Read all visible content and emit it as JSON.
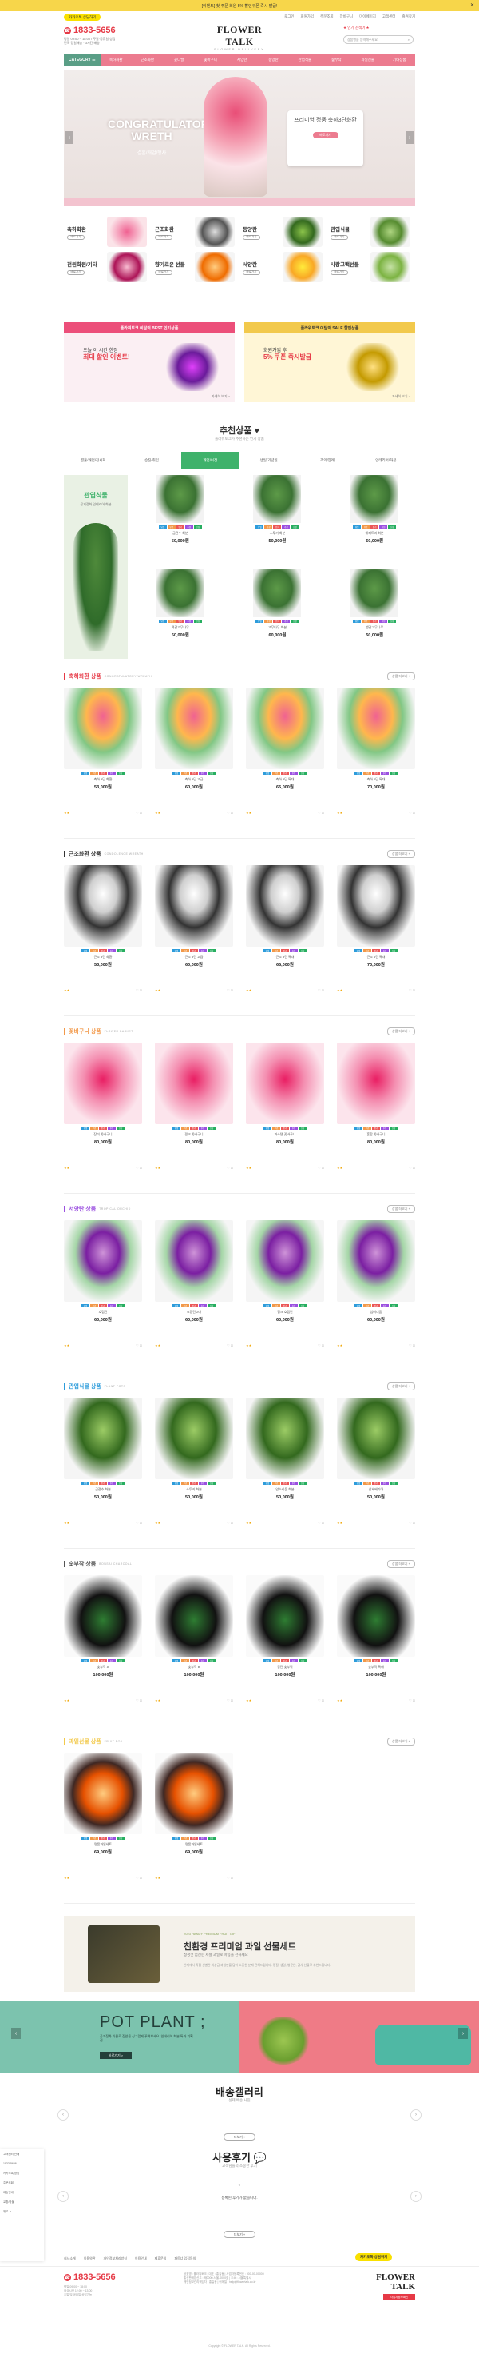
{
  "topbar": {
    "text": "[이벤트] 첫 주문 회원 5% 할인쿠폰 즉시 발급!",
    "close": "✕"
  },
  "header": {
    "kakao_label": "카카오톡 상담하기",
    "links": [
      "로그인",
      "회원가입",
      "주문조회",
      "장바구니",
      "마이페이지",
      "고객센터",
      "즐겨찾기"
    ],
    "phone": "1833-5656",
    "phone_hours": "평일 09:00 ~ 18:00 / 주말·공휴일 상담",
    "phone_hours2": "전국 당일배송 · 3시간 배송",
    "logo_main": "FLOWER TALK",
    "logo_sub": "FLOWER DELIVERY",
    "search_label": "★ 인기 검색어 ★",
    "search_placeholder": "상품명을 입력해주세요"
  },
  "nav": {
    "category": "CATEGORY ☰",
    "items": [
      "축하화환",
      "근조화환",
      "꽃다발",
      "꽃바구니",
      "서양란",
      "동양란",
      "관엽식물",
      "숲부작",
      "과일선물",
      "기타상품"
    ]
  },
  "hero": {
    "title": "CONGRATULATORY WRETH",
    "subtitle": "결혼/개업/행사",
    "card_text": "프리미엄 정품 축하3단화환",
    "card_button": "바로가기",
    "prev": "‹",
    "next": "›"
  },
  "categories": [
    {
      "name": "축하화환",
      "btn": "바로가기"
    },
    {
      "name": "근조화환",
      "btn": "바로가기"
    },
    {
      "name": "동양란",
      "btn": "바로가기"
    },
    {
      "name": "관엽식물",
      "btn": "바로가기"
    },
    {
      "name": "전원화원/기타",
      "btn": "바로가기"
    },
    {
      "name": "향기로운 선물",
      "btn": "바로가기"
    },
    {
      "name": "서양란",
      "btn": "바로가기"
    },
    {
      "name": "사랑고백선물",
      "btn": "바로가기"
    }
  ],
  "promo_banners": [
    {
      "header": "플라워토크 이달의 BEST 인기상품",
      "line1": "오늘 이 시간 한정",
      "line2": "최대 할인 이벤트!",
      "more": "자세히 보기 >"
    },
    {
      "header": "플라워토크 이달의 SALE 할인상품",
      "line1": "회원가입 후",
      "line2": "5% 쿠폰 즉시발급",
      "more": "자세히 보기 >"
    }
  ],
  "recommend": {
    "title": "추천상품 ♥",
    "subtitle": "플라워토크가 추천하는 인기 상품",
    "tabs": [
      "결혼/개업/전시회",
      "승진/취임",
      "개업/이전",
      "생일/기념일",
      "조의/장례",
      "인테리어/화분"
    ],
    "active_tab": 2,
    "featured_title": "관엽식물",
    "featured_sub": "공기정화 인테리어 화분",
    "items": [
      {
        "name": "금전수 화분",
        "price": "50,000원"
      },
      {
        "name": "스투키 화분",
        "price": "50,000원"
      },
      {
        "name": "해피트리 화분",
        "price": "50,000원"
      },
      {
        "name": "떡갈고무나무",
        "price": "60,000원"
      },
      {
        "name": "고무나무 화분",
        "price": "60,000원"
      },
      {
        "name": "뱅갈고무나무",
        "price": "50,000원"
      }
    ]
  },
  "badge_colors": [
    "#2d9cdb",
    "#f2994a",
    "#eb5757",
    "#9b51e0",
    "#27ae60"
  ],
  "badge_labels": [
    "당일",
    "무료",
    "인기",
    "추천",
    "신상"
  ],
  "sections": [
    {
      "title": "축하화환 상품",
      "en": "CONGRATULATORY WREATH",
      "color": "#e63946",
      "more": "상품 더보기 +",
      "items": [
        {
          "name": "축하 3단 화환",
          "price": "53,000원"
        },
        {
          "name": "축하 3단 고급",
          "price": "60,000원"
        },
        {
          "name": "축하 3단 특대",
          "price": "65,000원"
        },
        {
          "name": "축하 4단 특대",
          "price": "70,000원"
        }
      ]
    },
    {
      "title": "근조화환 상품",
      "en": "CONDOLENCE WREATH",
      "color": "#333333",
      "more": "상품 더보기 +",
      "items": [
        {
          "name": "근조 3단 화환",
          "price": "53,000원"
        },
        {
          "name": "근조 3단 고급",
          "price": "60,000원"
        },
        {
          "name": "근조 3단 특대",
          "price": "65,000원"
        },
        {
          "name": "근조 4단 특대",
          "price": "70,000원"
        }
      ]
    },
    {
      "title": "꽃바구니 상품",
      "en": "FLOWER BASKET",
      "color": "#f2994a",
      "more": "상품 더보기 +",
      "items": [
        {
          "name": "장미 꽃바구니",
          "price": "80,000원"
        },
        {
          "name": "핑크 꽃바구니",
          "price": "80,000원"
        },
        {
          "name": "파스텔 꽃바구니",
          "price": "80,000원"
        },
        {
          "name": "혼합 꽃바구니",
          "price": "80,000원"
        }
      ]
    },
    {
      "title": "서양란 상품",
      "en": "TROPICAL ORCHID",
      "color": "#9b51e0",
      "more": "상품 더보기 +",
      "items": [
        {
          "name": "호접란",
          "price": "60,000원"
        },
        {
          "name": "호접란 2대",
          "price": "60,000원"
        },
        {
          "name": "핑크 호접란",
          "price": "60,000원"
        },
        {
          "name": "심비디움",
          "price": "60,000원"
        }
      ]
    },
    {
      "title": "관엽식물 상품",
      "en": "PLANT POTS",
      "color": "#2d9cdb",
      "more": "상품 더보기 +",
      "items": [
        {
          "name": "금전수 화분",
          "price": "50,000원"
        },
        {
          "name": "스투키 화분",
          "price": "50,000원"
        },
        {
          "name": "안스리움 화분",
          "price": "50,000원"
        },
        {
          "name": "산세베리아",
          "price": "50,000원"
        }
      ]
    },
    {
      "title": "숯부작 상품",
      "en": "BONSAI CHARCOAL",
      "color": "#555555",
      "more": "상품 더보기 +",
      "items": [
        {
          "name": "숯부작 A",
          "price": "100,000원"
        },
        {
          "name": "숯부작 B",
          "price": "100,000원"
        },
        {
          "name": "풍란 숯부작",
          "price": "100,000원"
        },
        {
          "name": "숯부작 특대",
          "price": "100,000원"
        }
      ]
    },
    {
      "title": "과일선물 상품",
      "en": "FRUIT BOX",
      "color": "#f2c94c",
      "more": "상품 더보기 +",
      "items": [
        {
          "name": "명품과일세트",
          "price": "69,000원"
        },
        {
          "name": "명품과일세트",
          "price": "69,000원"
        }
      ]
    }
  ],
  "fruit_banner": {
    "tag": "2023 HANDY PREMIUM FRUIT GIFT",
    "title": "친환경 프리미엄 과일 선물세트",
    "sub": "정성껏 엄선한 제철 과일로 마음을 전하세요",
    "desc": "산지에서 직접 선별한 최상급 과일만을 담아 소중한 분께 전해드립니다. 명절, 생일, 병문안, 감사 선물로 추천드립니다."
  },
  "pot_banner": {
    "title": "POT PLANT ;",
    "desc": "공기정화 식물로 집안을 싱그럽게 꾸며보세요. 인테리어 화분 특가 기획전",
    "button": "바로가기 >",
    "prev": "‹",
    "next": "›"
  },
  "gallery": {
    "title": "배송갤러리",
    "sub": "실제 배송 사진",
    "btn": "더보기 +",
    "prev": "‹",
    "next": "›"
  },
  "reviews": {
    "title": "사용후기 💬",
    "sub": "고객님들의 소중한 후기",
    "empty": "등록된 후기가 없습니다.",
    "btn": "더보기 +",
    "prev": "‹",
    "next": "›"
  },
  "chat_popup": [
    "고객센터 안내",
    "1833-5656",
    "카카오톡 상담",
    "주문조회",
    "배송안내",
    "교환/환불",
    "위로 ▲"
  ],
  "footer": {
    "links": [
      "회사소개",
      "이용약관",
      "개인정보처리방침",
      "이용안내",
      "제휴문의",
      "파트너 입점문의"
    ],
    "kakao": "카카오톡 상담하기",
    "phone": "1833-5656",
    "info": "평일 09:00 ~ 18:00\n점심시간 12:00 ~ 13:00\n주말 및 공휴일 상담가능",
    "company": "상호명 : 플라워토크 | 대표 : 홍길동 | 사업자등록번호 : 000-00-00000\n통신판매업신고 : 제0000-서울-0000호 | 주소 : 서울특별시\n개인정보관리책임자 : 홍길동 | 이메일 : help@flowertalk.co.kr",
    "logo": "FLOWER TALK",
    "logo_btn": "사업자정보확인",
    "copyright": "Copyright © FLOWER TALK. All Rights Reserved."
  }
}
